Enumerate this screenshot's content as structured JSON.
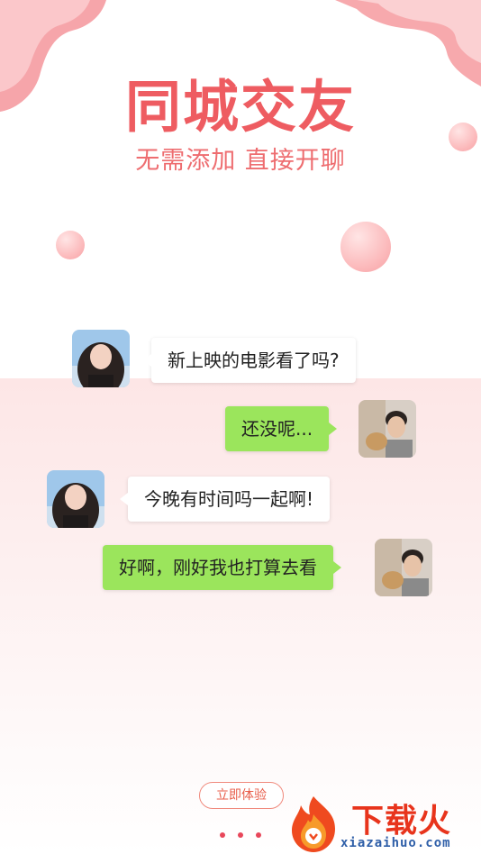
{
  "header": {
    "title": "同城交友",
    "subtitle": "无需添加 直接开聊"
  },
  "chat": {
    "messages": [
      {
        "side": "left",
        "text": "新上映的电影看了吗?",
        "avatar": "female-avatar"
      },
      {
        "side": "right",
        "text": "还没呢...",
        "avatar": "male-avatar"
      },
      {
        "side": "left",
        "text": "今晚有时间吗一起啊!",
        "avatar": "female-avatar"
      },
      {
        "side": "right",
        "text": "好啊，刚好我也打算去看",
        "avatar": "male-avatar"
      }
    ]
  },
  "footer": {
    "cta_label": "立即体验",
    "page_indicator": {
      "count": 3,
      "active": 0
    }
  },
  "watermark": {
    "brand": "下载火",
    "url": "xiazaihuo.com"
  },
  "colors": {
    "title": "#ee5c61",
    "incoming_bubble": "#ffffff",
    "outgoing_bubble": "#9be55c",
    "accent": "#e8475a"
  }
}
